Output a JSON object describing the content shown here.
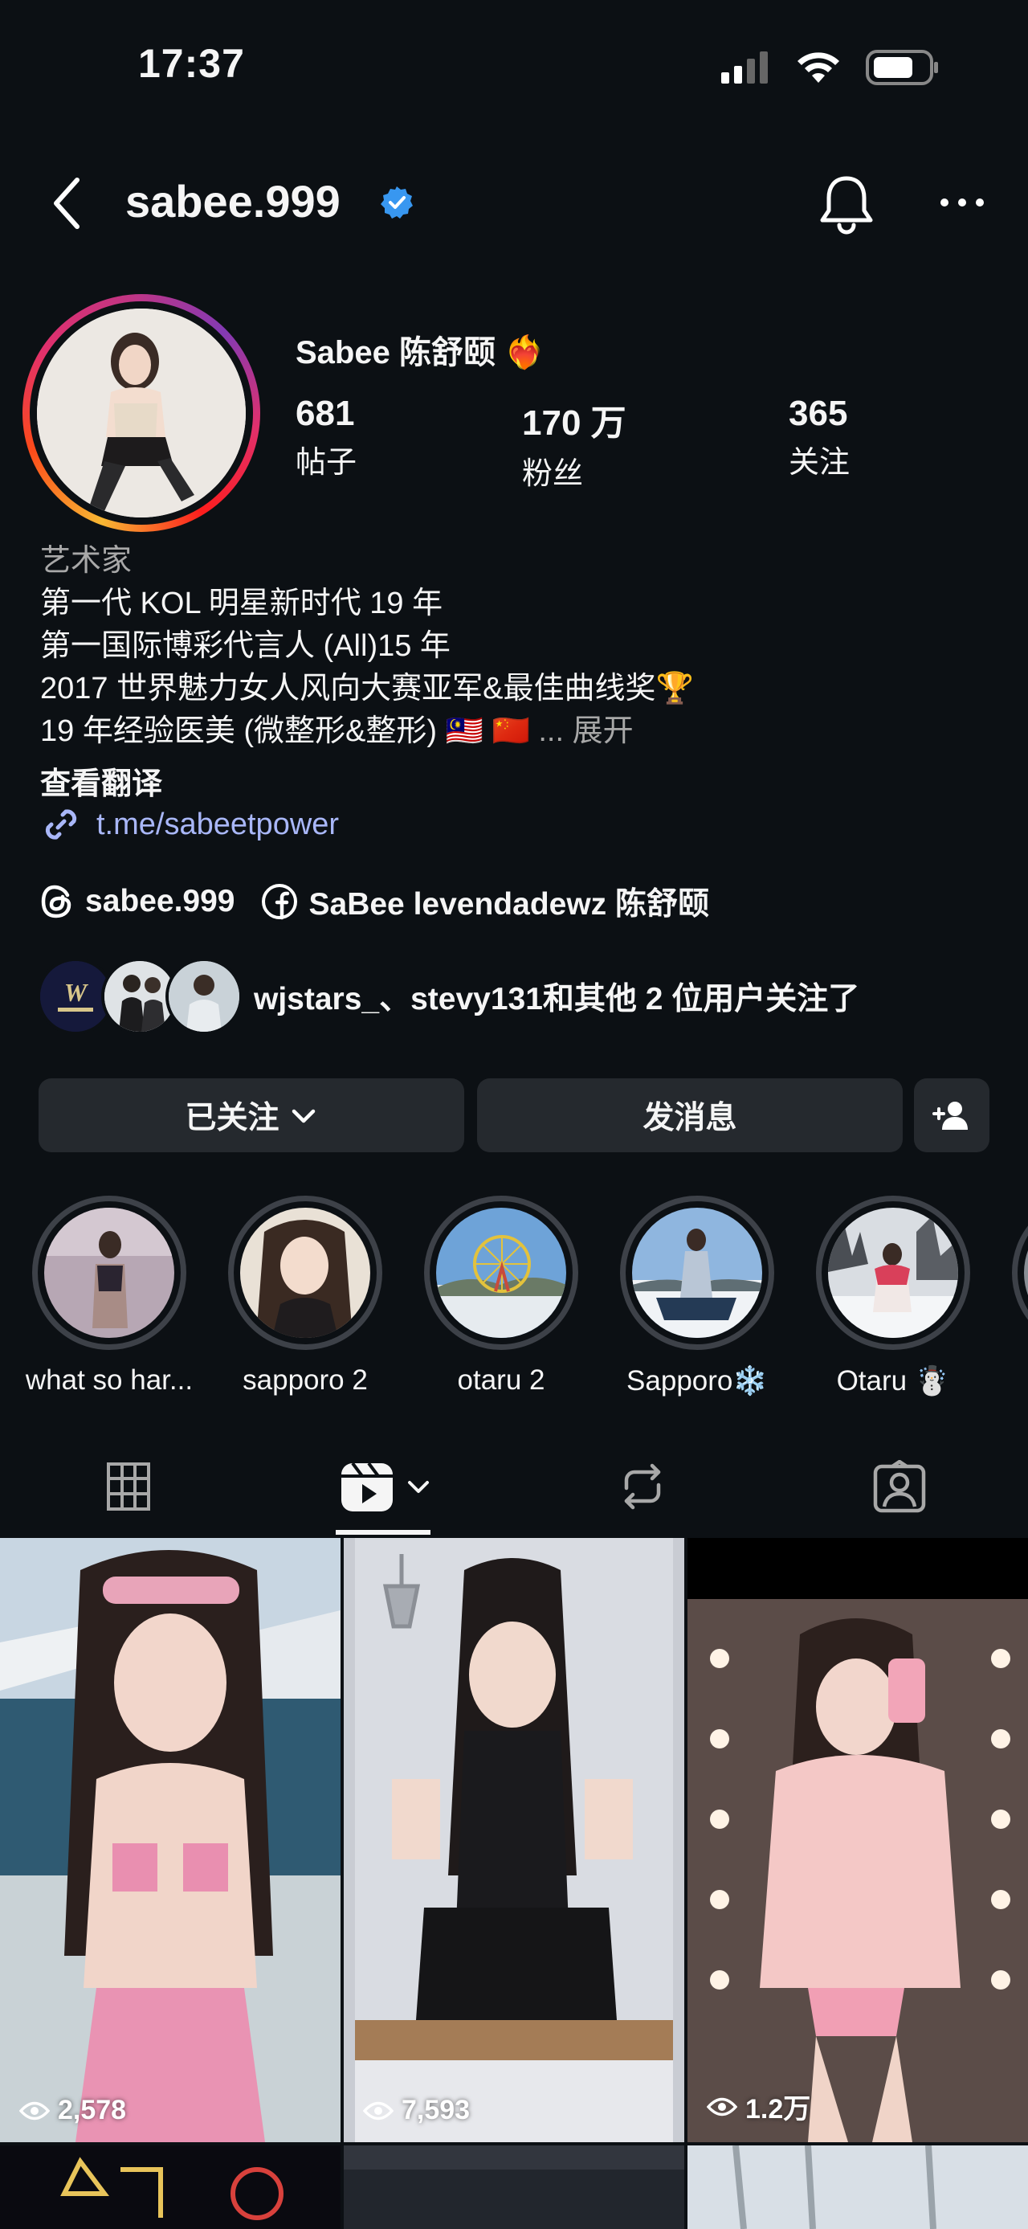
{
  "status_bar": {
    "time": "17:37"
  },
  "header": {
    "username": "sabee.999"
  },
  "profile": {
    "display_name": "Sabee 陈舒颐",
    "display_name_emoji": "❤️‍🔥",
    "stats": [
      {
        "value": "681",
        "label": "帖子"
      },
      {
        "value": "170 万",
        "label": "粉丝"
      },
      {
        "value": "365",
        "label": "关注"
      }
    ]
  },
  "bio": {
    "category": "艺术家",
    "line1": "第一代 KOL 明星新时代 19 年",
    "line2": "第一国际博彩代言人 (All)15 年",
    "line3": "2017 世界魅力女人风向大赛亚军&最佳曲线奖🏆",
    "line4": "19 年经验医美 (微整形&整形) 🇲🇾 🇨🇳 ",
    "more": "... 展开",
    "translate": "查看翻译",
    "link": "t.me/sabeetpower"
  },
  "social": {
    "threads_handle": "sabee.999",
    "facebook_name": "SaBee levendadewz 陈舒颐"
  },
  "followed_by": {
    "text": "wjstars_、stevy131和其他 2 位用户关注了"
  },
  "actions": {
    "following_label": "已关注",
    "message_label": "发消息"
  },
  "highlights": [
    {
      "label": "what so har..."
    },
    {
      "label": "sapporo 2"
    },
    {
      "label": "otaru 2"
    },
    {
      "label": "Sapporo❄️"
    },
    {
      "label": "Otaru ☃️"
    }
  ],
  "grid": {
    "posts": [
      {
        "views": "2,578"
      },
      {
        "views": "7,593"
      },
      {
        "views": "1.2万"
      }
    ]
  },
  "colors": {
    "background": "#0c1014",
    "button_bg": "#25292e",
    "link": "#a9b7f8",
    "verified": "#3897f0",
    "muted": "#a8a8a8"
  },
  "icons": [
    "back-arrow-icon",
    "verified-badge-icon",
    "bell-icon",
    "more-icon",
    "link-icon",
    "threads-icon",
    "facebook-icon",
    "chevron-down-icon",
    "add-person-icon",
    "grid-icon",
    "reels-icon",
    "repost-icon",
    "tagged-icon",
    "eye-icon"
  ]
}
